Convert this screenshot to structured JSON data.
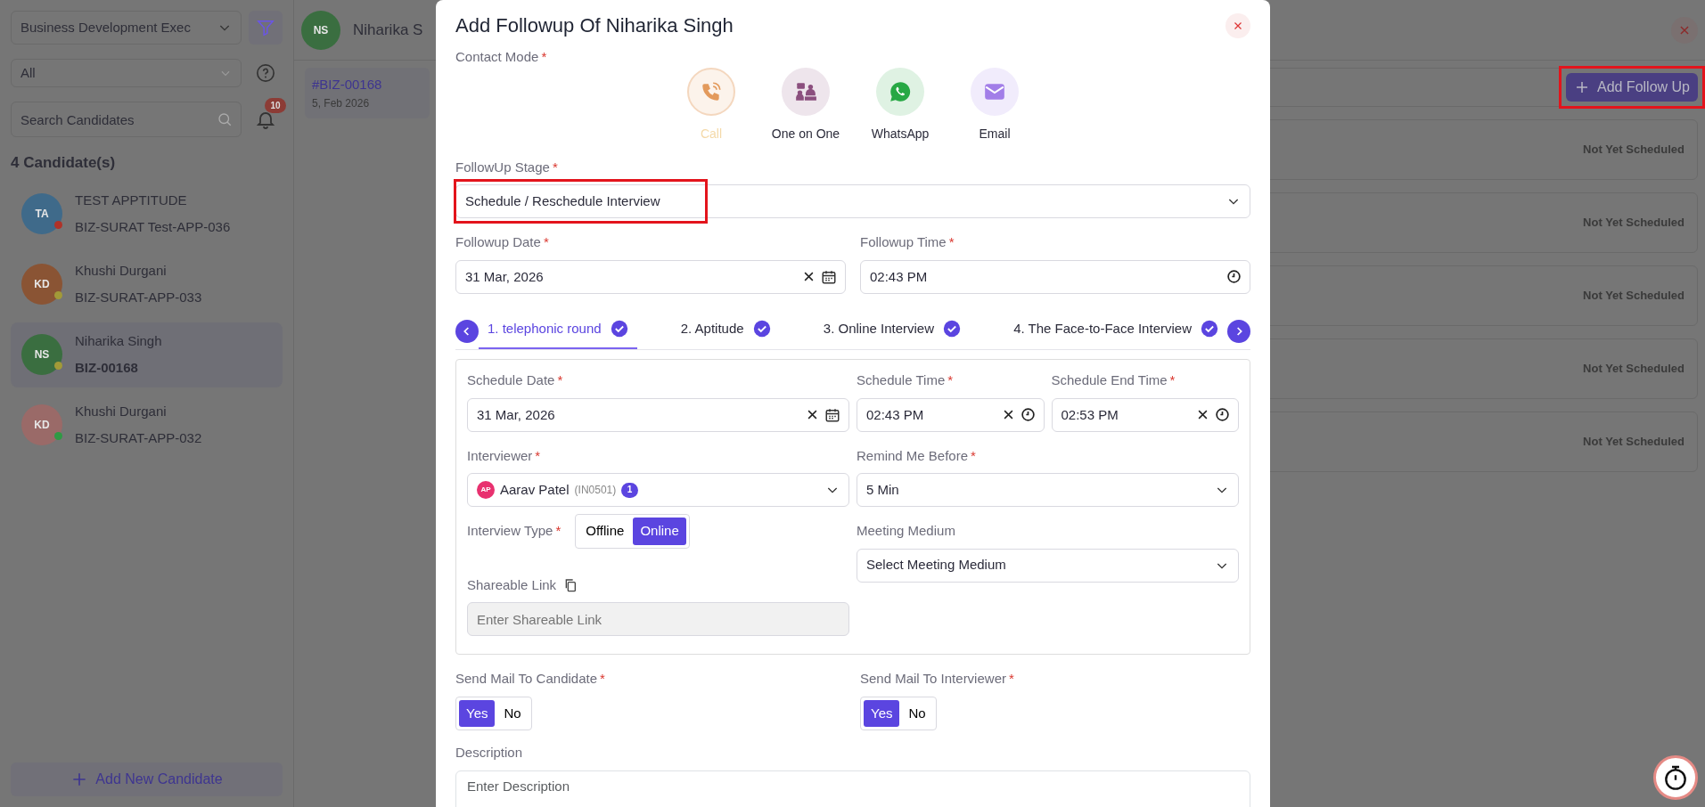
{
  "sidebar": {
    "role_filter": "Business Development Exec",
    "status_filter": "All",
    "search_placeholder": "Search Candidates",
    "notification_count": "10",
    "count_label": "4 Candidate(s)",
    "candidates": [
      {
        "initials": "TA",
        "name": "TEST APPTITUDE",
        "code": "BIZ-SURAT Test-APP-036",
        "color": "#3f6a8a",
        "status_dot": {
          "color": "#b03228"
        },
        "selected": false
      },
      {
        "initials": "KD",
        "name": "Khushi Durgani",
        "code": "BIZ-SURAT-APP-033",
        "color": "#8a5434",
        "status_dot": {
          "color": "#a29a38"
        },
        "selected": false
      },
      {
        "initials": "NS",
        "name": "Niharika Singh",
        "code": "BIZ-00168",
        "color": "#3a6e40",
        "status_dot": {
          "color": "#a29a38"
        },
        "selected": true
      },
      {
        "initials": "KD",
        "name": "Khushi Durgani",
        "code": "BIZ-SURAT-APP-032",
        "color": "#9a6a68",
        "status_dot": {
          "color": "#2f9a44"
        },
        "selected": false
      }
    ],
    "add_button": "Add New Candidate"
  },
  "main": {
    "initials": "NS",
    "name": "Niharika S",
    "avatar": {
      "color": "#3a6e40"
    },
    "application": {
      "code": "#BIZ-00168",
      "date": "5, Feb 2026"
    },
    "add_followup": {
      "label": "Add Follow Up",
      "highlighted": true
    },
    "followups": [
      {
        "status": "Not Yet Scheduled"
      },
      {
        "status": "Not Yet Scheduled"
      },
      {
        "status": "Not Yet Scheduled"
      },
      {
        "status": "Not Yet Scheduled"
      },
      {
        "status": "Not Yet Scheduled"
      }
    ]
  },
  "modal": {
    "title": "Add Followup Of Niharika Singh",
    "contact_mode": {
      "label": "Contact Mode",
      "mark": "*",
      "options": [
        {
          "kind": "call",
          "label": "Call",
          "color": "#e39a5c",
          "selected": true
        },
        {
          "kind": "meeting",
          "label": "One on One",
          "color": "#8b4f7e",
          "selected": false
        },
        {
          "kind": "whatsapp",
          "label": "WhatsApp",
          "color": "#27a844",
          "selected": false
        },
        {
          "kind": "email",
          "label": "Email",
          "color": "#a27ee8",
          "selected": false
        }
      ]
    },
    "stage": {
      "label": "FollowUp Stage",
      "mark": "*",
      "value": "Schedule / Reschedule Interview",
      "highlighted": true
    },
    "followup_date": {
      "label": "Followup Date",
      "mark": "*",
      "value": "31 Mar, 2026"
    },
    "followup_time": {
      "label": "Followup Time",
      "mark": "*",
      "value": "02:43 PM"
    },
    "rounds": [
      {
        "label": "1. telephonic round",
        "done": true,
        "selected": true
      },
      {
        "label": "2. Aptitude",
        "done": true,
        "selected": false
      },
      {
        "label": "3. Online Interview",
        "done": true,
        "selected": false
      },
      {
        "label": "4. The Face-to-Face Interview",
        "done": true,
        "selected": false
      }
    ],
    "schedule_date": {
      "label": "Schedule Date",
      "mark": "*",
      "value": "31 Mar, 2026"
    },
    "schedule_time": {
      "label": "Schedule Time",
      "mark": "*",
      "value": "02:43 PM"
    },
    "schedule_end_time": {
      "label": "Schedule End Time",
      "mark": "*",
      "value": "02:53 PM"
    },
    "interviewer": {
      "label": "Interviewer",
      "mark": "*",
      "initials": "AP",
      "name": "Aarav Patel",
      "code": "(IN0501)",
      "count": "1"
    },
    "remind": {
      "label": "Remind Me Before",
      "mark": "*",
      "value": "5 Min"
    },
    "interview_type": {
      "label": "Interview Type",
      "mark": "*",
      "options": [
        {
          "label": "Offline",
          "selected": false
        },
        {
          "label": "Online",
          "selected": true
        }
      ]
    },
    "meeting_medium": {
      "label": "Meeting Medium",
      "placeholder": "Select Meeting Medium"
    },
    "shareable_link": {
      "label": "Shareable Link",
      "placeholder": "Enter Shareable Link",
      "disabled": true
    },
    "mail_candidate": {
      "label": "Send Mail To Candidate",
      "mark": "*",
      "options": [
        {
          "label": "Yes",
          "selected": true
        },
        {
          "label": "No",
          "selected": false
        }
      ]
    },
    "mail_interviewer": {
      "label": "Send Mail To Interviewer",
      "mark": "*",
      "options": [
        {
          "label": "Yes",
          "selected": true
        },
        {
          "label": "No",
          "selected": false
        }
      ]
    },
    "description": {
      "label": "Description",
      "placeholder": "Enter Description"
    }
  }
}
